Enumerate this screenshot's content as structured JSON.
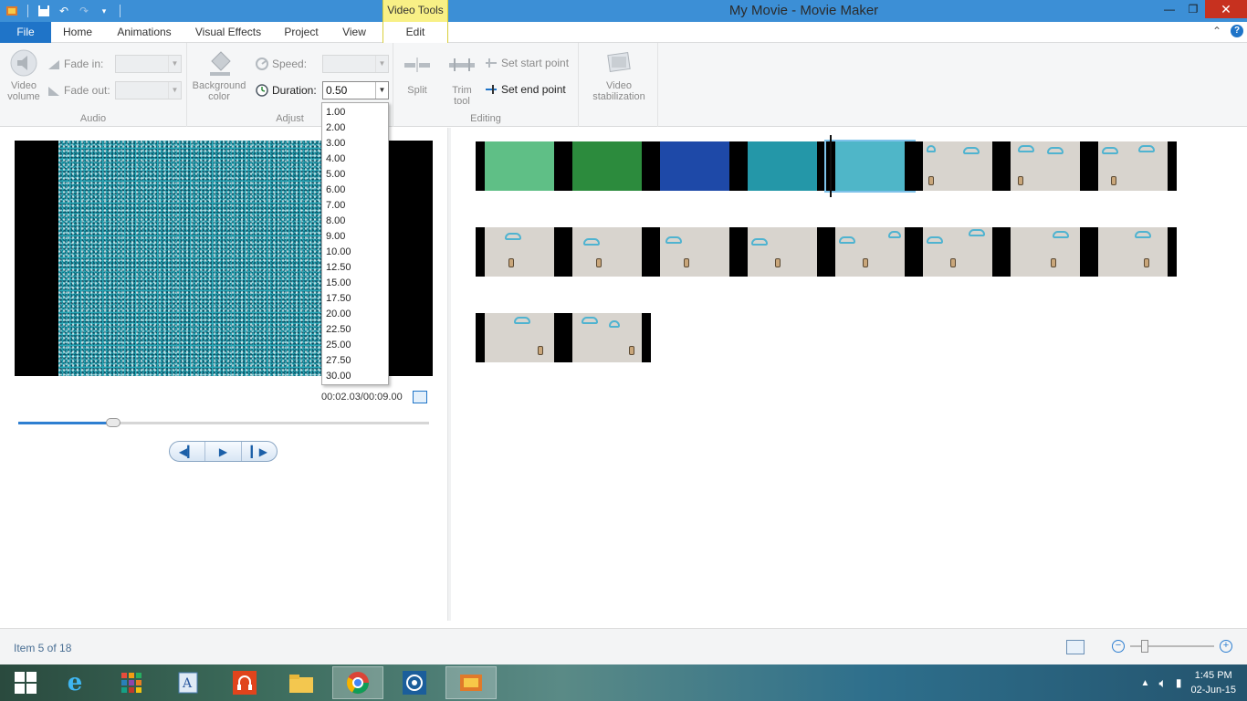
{
  "window": {
    "title": "My Movie - Movie Maker",
    "contextual_tab_group": "Video Tools"
  },
  "tabs": {
    "file": "File",
    "home": "Home",
    "animations": "Animations",
    "visual_effects": "Visual Effects",
    "project": "Project",
    "view": "View",
    "edit": "Edit"
  },
  "ribbon": {
    "audio": {
      "group_label": "Audio",
      "video_volume_line1": "Video",
      "video_volume_line2": "volume",
      "fade_in_label": "Fade in:",
      "fade_out_label": "Fade out:"
    },
    "adjust": {
      "group_label": "Adjust",
      "background_color_line1": "Background",
      "background_color_line2": "color",
      "speed_label": "Speed:",
      "duration_label": "Duration:",
      "duration_value": "0.50"
    },
    "editing": {
      "group_label": "Editing",
      "split_label": "Split",
      "trim_line1": "Trim",
      "trim_line2": "tool",
      "set_start_point": "Set start point",
      "set_end_point": "Set end point"
    },
    "stabilization": {
      "line1": "Video",
      "line2": "stabilization"
    }
  },
  "duration_options": [
    "1.00",
    "2.00",
    "3.00",
    "4.00",
    "5.00",
    "6.00",
    "7.00",
    "8.00",
    "9.00",
    "10.00",
    "12.50",
    "15.00",
    "17.50",
    "20.00",
    "22.50",
    "25.00",
    "27.50",
    "30.00"
  ],
  "preview": {
    "timecode": "00:02.03/00:09.00",
    "progress": 0.23
  },
  "status": {
    "item_text": "Item 5 of 18"
  },
  "clock": {
    "time": "1:45 PM",
    "date": "02-Jun-15"
  },
  "colors": {
    "accent": "#1f74c8",
    "contextual": "#f8f086",
    "close": "#c7311f"
  }
}
